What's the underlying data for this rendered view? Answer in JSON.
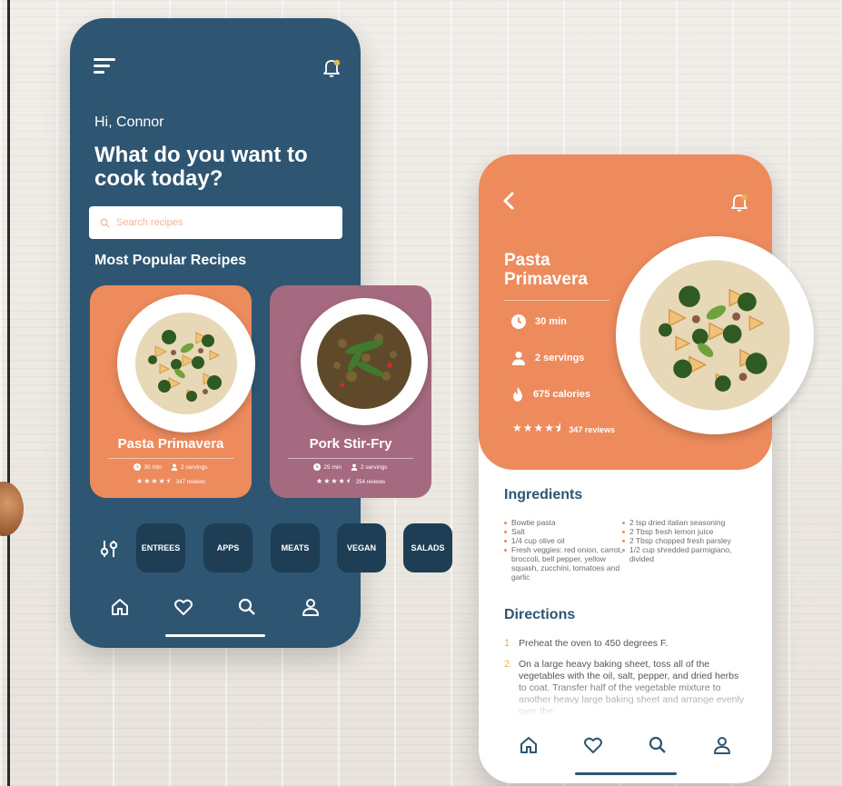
{
  "colors": {
    "navy": "#2e5672",
    "orange": "#ed8b5d",
    "mauve": "#a56a80",
    "dark_tile": "#1e3e56"
  },
  "home": {
    "greeting": "Hi, Connor",
    "headline": "What do you want to cook today?",
    "search_placeholder": "Search recipes",
    "section_title": "Most Popular Recipes",
    "recipes": [
      {
        "title": "Pasta Primavera",
        "time": "30 min",
        "servings": "2 servings",
        "reviews": "347 reviews",
        "rating": 4.5
      },
      {
        "title": "Pork Stir-Fry",
        "time": "25 min",
        "servings": "2 servings",
        "reviews": "254 reviews",
        "rating": 4.5
      }
    ],
    "categories": [
      "ENTREES",
      "APPS",
      "MEATS",
      "VEGAN",
      "SALADS"
    ],
    "nav": [
      "home-icon",
      "heart-icon",
      "search-icon",
      "user-icon"
    ]
  },
  "detail": {
    "title": "Pasta Primavera",
    "time": "30 min",
    "servings": "2 servings",
    "calories": "675 calories",
    "reviews": "347 reviews",
    "rating": 4.5,
    "ingredients_title": "Ingredients",
    "ingredients_left": [
      "Bowtie pasta",
      "Salt",
      "1/4 cup olive oil",
      "Fresh veggies: red onion, carrot, broccoli, bell pepper, yellow squash, zucchini, tomatoes and garlic"
    ],
    "ingredients_right": [
      "2 tsp dried italian seasoning",
      "2 Tbsp fresh lemon juice",
      "2 Tbsp chopped fresh parsley",
      "1/2 cup shredded parmigiano, divided"
    ],
    "directions_title": "Directions",
    "directions": [
      {
        "num": "1",
        "text": "Preheat the oven to 450 degrees F."
      },
      {
        "num": "2",
        "text": "On a large heavy baking sheet, toss all of the vegetables with the oil, salt, pepper, and dried herbs to coat. Transfer half of the vegetable mixture to another heavy large baking sheet and arrange evenly over the"
      }
    ]
  }
}
